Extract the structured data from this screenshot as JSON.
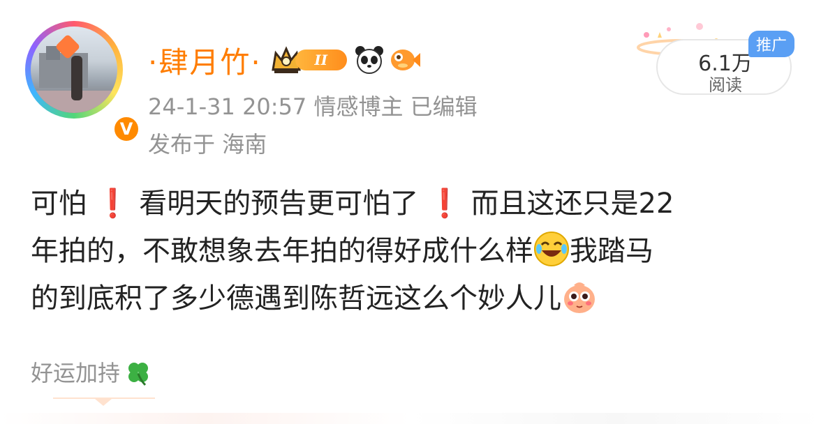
{
  "post": {
    "username": "·肆月竹·",
    "level_badge": "II",
    "meta": "24-1-31 20:57  情感博主  已编辑",
    "location": "发布于 海南",
    "read_count": "6.1万",
    "read_label": "阅读",
    "promo_tag": "推广",
    "verified_mark": "V",
    "body": {
      "line1_a": "可怕",
      "line1_ex1": "❗",
      "line1_b": "看明天的预告更可怕了",
      "line1_ex2": "❗",
      "line1_c": "而且这还只是22",
      "line2_a": "年拍的，不敢想象去年拍的得好成什么样",
      "line2_b": "我踏马",
      "line3": "的到底积了多少德遇到陈哲远这么个妙人儿"
    },
    "footer_text": "好运加持"
  },
  "icons": {
    "avatar": "user-avatar",
    "verify": "verified-icon",
    "crown": "crown-icon",
    "panda": "panda-icon",
    "fish": "fish-icon",
    "laugh": "laughing-emoji-icon",
    "blush": "blush-emoji-icon",
    "clover": "clover-icon"
  },
  "colors": {
    "username": "#ff7d00",
    "meta": "#939393",
    "promo": "#5a9ff4",
    "exclamation": "#e82b2b"
  }
}
